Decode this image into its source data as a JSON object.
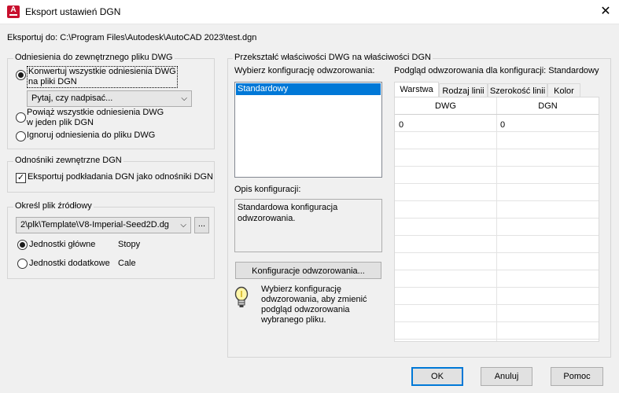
{
  "window": {
    "title": "Eksport ustawień DGN",
    "app_icon_letter": "A",
    "close_glyph": "✕"
  },
  "export_path": "Eksportuj do: C:\\Program Files\\Autodesk\\AutoCAD 2023\\test.dgn",
  "xref_group": {
    "legend": "Odniesienia do zewnętrznego pliku DWG",
    "opt_convert_line1": "Konwertuj wszystkie odniesienia DWG",
    "opt_convert_line2": "na pliki DGN",
    "overwrite_combo": "Pytaj, czy nadpisać...",
    "opt_bind_line1": "Powiąż wszystkie odniesienia DWG",
    "opt_bind_line2": "w jeden plik DGN",
    "opt_ignore": "Ignoruj odniesienia do pliku DWG"
  },
  "dgn_refs_group": {
    "legend": "Odnośniki zewnętrzne DGN",
    "export_underlays": "Eksportuj podkładania DGN jako odnośniki DGN"
  },
  "seed_group": {
    "legend": "Określ plik źródłowy",
    "seed_file": "2\\plk\\Template\\V8-Imperial-Seed2D.dg",
    "browse_label": "...",
    "master_units_label": "Jednostki główne",
    "master_units_value": "Stopy",
    "sub_units_label": "Jednostki dodatkowe",
    "sub_units_value": "Cale"
  },
  "mapping_group": {
    "legend": "Przekształć właściwości DWG na właściwości DGN",
    "select_config_label": "Wybierz konfigurację odwzorowania:",
    "configs": [
      "Standardowy"
    ],
    "description_label": "Opis konfiguracji:",
    "description_text": "Standardowa konfiguracja odwzorowania.",
    "config_button": "Konfiguracje odwzorowania...",
    "hint_text": "Wybierz konfigurację odwzorowania, aby zmienić podgląd odwzorowania wybranego pliku.",
    "preview_label": "Podgląd odwzorowania dla konfiguracji: Standardowy",
    "tabs": [
      "Warstwa",
      "Rodzaj linii",
      "Szerokość linii",
      "Kolor"
    ],
    "columns": [
      "DWG",
      "DGN"
    ],
    "rows": [
      [
        "0",
        "0"
      ]
    ]
  },
  "footer": {
    "ok": "OK",
    "cancel": "Anuluj",
    "help": "Pomoc"
  }
}
